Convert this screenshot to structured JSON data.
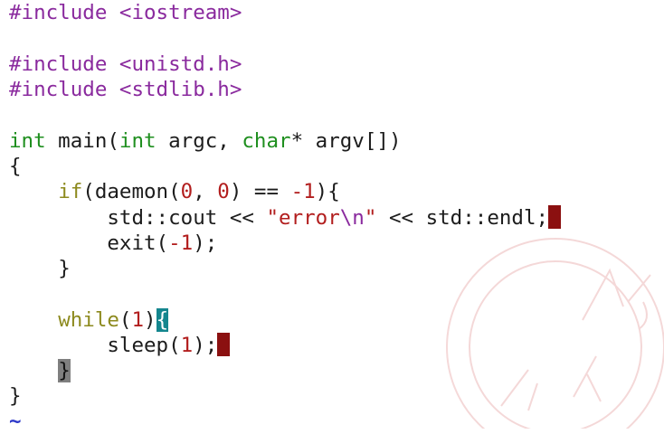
{
  "editor": {
    "lines": {
      "l1": {
        "directive": "#include",
        "header": "<iostream>"
      },
      "l3": {
        "directive": "#include",
        "header": "<unistd.h>"
      },
      "l4": {
        "directive": "#include",
        "header": "<stdlib.h>"
      },
      "l6": {
        "type1": "int",
        "fname": " main(",
        "type2": "int",
        "p1": " argc, ",
        "type3": "char",
        "p2": "* argv[])"
      },
      "l7": {
        "text": "{"
      },
      "l8": {
        "indent": "    ",
        "kw": "if",
        "a": "(daemon(",
        "n1": "0",
        "b": ", ",
        "n2": "0",
        "c": ") == ",
        "n3": "-1",
        "d": "){"
      },
      "l9": {
        "indent": "        ",
        "a": "std::cout << ",
        "str1": "\"error",
        "esc": "\\n",
        "str2": "\"",
        "b": " << std::endl;"
      },
      "l10": {
        "indent": "        ",
        "a": "exit(",
        "n": "-1",
        "b": ");"
      },
      "l11": {
        "indent": "    ",
        "text": "}"
      },
      "l13": {
        "indent": "    ",
        "kw": "while",
        "a": "(",
        "n": "1",
        "b": ")",
        "brace": "{"
      },
      "l14": {
        "indent": "        ",
        "a": "sleep(",
        "n": "1",
        "b": ");"
      },
      "l15": {
        "indent": "    ",
        "brace": "}"
      },
      "l16": {
        "text": "}"
      },
      "l17": {
        "text": "~"
      }
    },
    "colors": {
      "preprocessor": "#8a2a9e",
      "type": "#1f8f1f",
      "keyword": "#8d8a1e",
      "string": "#b21e1e",
      "trailing_whitespace": "#8b1010",
      "match_paren": "#14868e",
      "cursor": "#7f7f7f",
      "empty_line_tilde": "#2d38c9"
    }
  }
}
